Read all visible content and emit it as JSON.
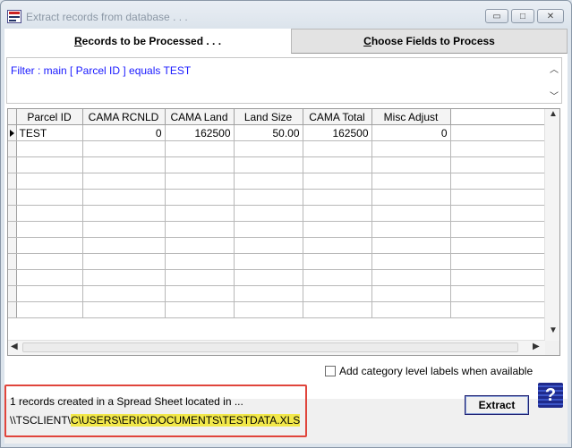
{
  "window": {
    "title": "Extract records from database . . .",
    "minimize_glyph": "▭",
    "maximize_glyph": "□",
    "close_glyph": "✕"
  },
  "tabs": [
    {
      "label_underlined": "R",
      "label_rest": "ecords to be Processed . . .",
      "active": true
    },
    {
      "label_underlined": "C",
      "label_rest": "hoose Fields to Process",
      "active": false
    }
  ],
  "filter": {
    "text": "Filter : main [ Parcel ID ] equals TEST"
  },
  "grid": {
    "columns": [
      "Parcel ID",
      "CAMA RCNLD",
      "CAMA Land",
      "Land Size",
      "CAMA Total",
      "Misc Adjust"
    ],
    "rows": [
      [
        "TEST",
        "0",
        "162500",
        "50.00",
        "162500",
        "0"
      ]
    ],
    "empty_row_count": 11
  },
  "checkbox": {
    "label": "Add category level labels when available",
    "checked": false
  },
  "status": {
    "line1": "1 records created in a Spread Sheet located in ...",
    "path_prefix": "\\\\TSCLIENT\\",
    "path_highlight": "C\\USERS\\ERIC\\DOCUMENTS\\TESTDATA.XLS"
  },
  "buttons": {
    "extract": "Extract",
    "help_glyph": "?"
  },
  "colors": {
    "filter_text": "#1a1aff",
    "status_border": "#e0453c",
    "highlight": "#f2e84a",
    "help_icon": "#1f2a8c"
  }
}
